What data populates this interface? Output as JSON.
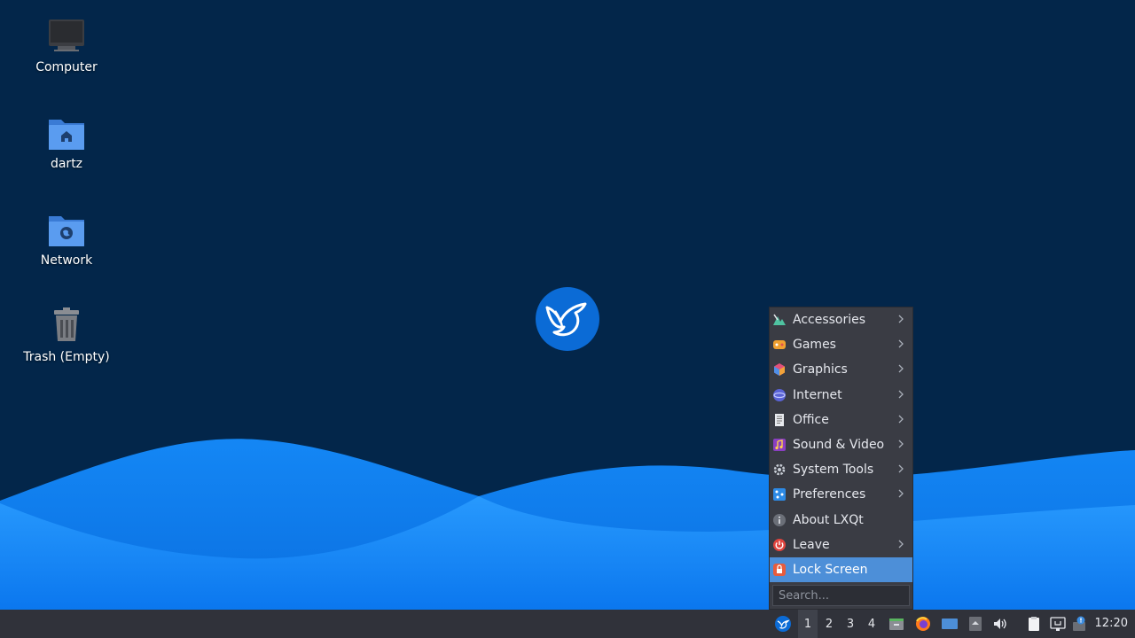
{
  "desktop": {
    "icons": [
      {
        "label": "Computer",
        "icon": "computer-icon"
      },
      {
        "label": "dartz",
        "icon": "home-folder-icon"
      },
      {
        "label": "Network",
        "icon": "network-folder-icon"
      },
      {
        "label": "Trash (Empty)",
        "icon": "trash-icon"
      }
    ]
  },
  "menu": {
    "items": [
      {
        "label": "Accessories",
        "icon": "accessories-icon",
        "submenu": true
      },
      {
        "label": "Games",
        "icon": "games-icon",
        "submenu": true
      },
      {
        "label": "Graphics",
        "icon": "graphics-icon",
        "submenu": true
      },
      {
        "label": "Internet",
        "icon": "internet-icon",
        "submenu": true
      },
      {
        "label": "Office",
        "icon": "office-icon",
        "submenu": true
      },
      {
        "label": "Sound & Video",
        "icon": "sound-video-icon",
        "submenu": true
      },
      {
        "label": "System Tools",
        "icon": "system-tools-icon",
        "submenu": true
      },
      {
        "label": "Preferences",
        "icon": "preferences-icon",
        "submenu": true
      },
      {
        "label": "About LXQt",
        "icon": "about-icon",
        "submenu": false
      },
      {
        "label": "Leave",
        "icon": "power-icon",
        "submenu": true
      },
      {
        "label": "Lock Screen",
        "icon": "lock-icon",
        "submenu": false,
        "active": true
      }
    ],
    "search_placeholder": "Search..."
  },
  "taskbar": {
    "workspaces": [
      "1",
      "2",
      "3",
      "4"
    ],
    "current_workspace": "1",
    "clock": "12:20"
  },
  "colors": {
    "desktop_bg": "#03264a",
    "wave_light": "#1e8fff",
    "menu_bg": "#3a3c44",
    "menu_highlight": "#4d8fd8",
    "taskbar_bg": "#30323a"
  }
}
